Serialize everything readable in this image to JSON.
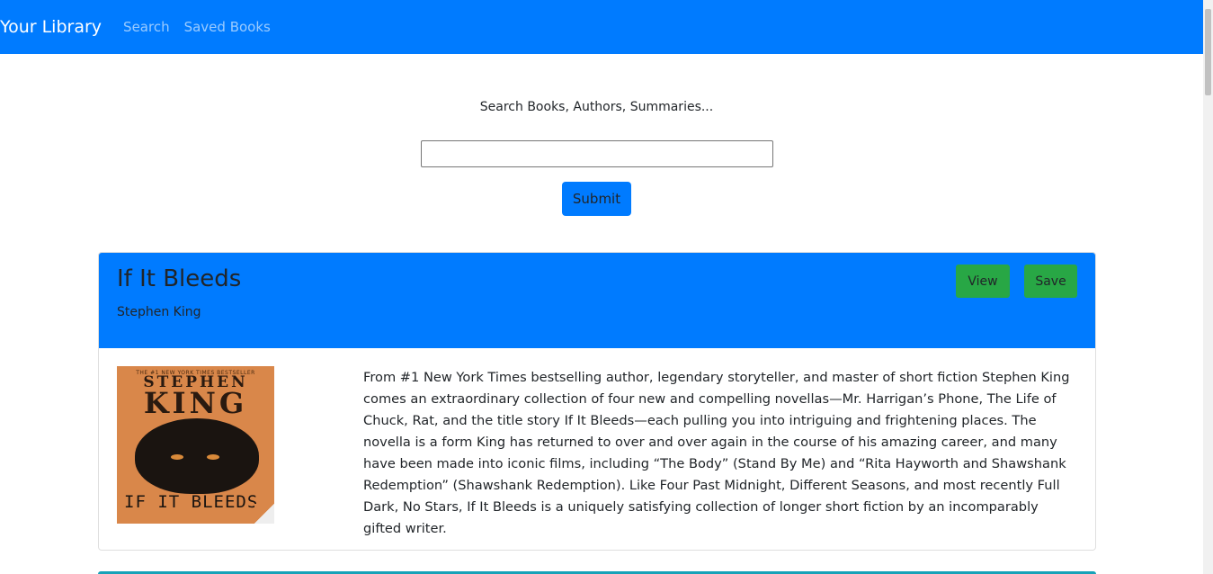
{
  "nav": {
    "brand": "Your Library",
    "links": [
      "Search",
      "Saved Books"
    ]
  },
  "search": {
    "label": "Search Books, Authors, Summaries...",
    "value": "",
    "submit_label": "Submit"
  },
  "results": [
    {
      "title": "If It Bleeds",
      "author": "Stephen King",
      "view_label": "View",
      "save_label": "Save",
      "cover": {
        "topline": "THE #1 NEW YORK TIMES BESTSELLER",
        "author_first": "STEPHEN",
        "author_last": "KING",
        "title_text": "IF IT BLEEDS"
      },
      "summary": "From #1 New York Times bestselling author, legendary storyteller, and master of short fiction Stephen King comes an extraordinary collection of four new and compelling novellas—Mr. Harrigan’s Phone, The Life of Chuck, Rat, and the title story If It Bleeds—each pulling you into intriguing and frightening places. The novella is a form King has returned to over and over again in the course of his amazing career, and many have been made into iconic films, including “The Body” (Stand By Me) and “Rita Hayworth and Shawshank Redemption” (Shawshank Redemption). Like Four Past Midnight, Different Seasons, and most recently Full Dark, No Stars, If It Bleeds is a uniquely satisfying collection of longer short fiction by an incomparably gifted writer."
    }
  ],
  "colors": {
    "primary": "#007bff",
    "success": "#28a745"
  }
}
